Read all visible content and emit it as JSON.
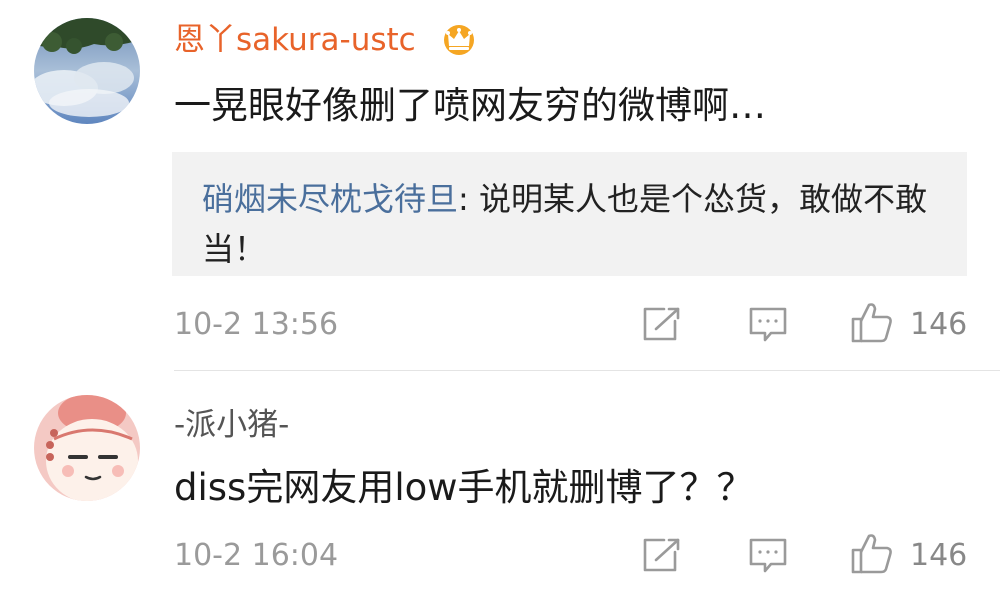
{
  "comments": [
    {
      "username": "恩丫sakura-ustc",
      "badge_icon": "crown-vip-icon",
      "text": "一晃眼好像删了喷网友穷的微博啊…",
      "reply": {
        "user": "硝烟未尽枕戈待旦",
        "separator": ": ",
        "text": "说明某人也是个怂货，敢做不敢当！"
      },
      "time": "10-2 13:56",
      "actions": {
        "share_icon": "share-icon",
        "comment_icon": "comment-icon",
        "like_icon": "thumbs-up-icon"
      },
      "likes": "146"
    },
    {
      "username": "-派小猪-",
      "text": "diss完网友用low手机就删博了？？",
      "time": "10-2 16:04",
      "actions": {
        "share_icon": "share-icon",
        "comment_icon": "comment-icon",
        "like_icon": "thumbs-up-icon"
      },
      "likes": "146"
    }
  ],
  "colors": {
    "vip_username": "#e8632a",
    "reply_username": "#4a6f9c",
    "meta_text": "#9a9a9a",
    "reply_background": "#f2f2f2",
    "crown": "#f5a623"
  }
}
